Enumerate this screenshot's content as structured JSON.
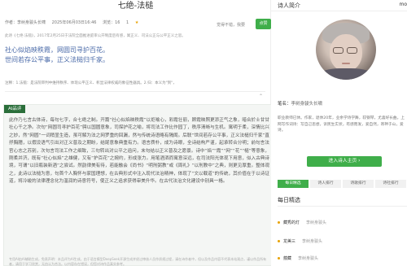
{
  "poem": {
    "title": "七绝-法槌",
    "meta_author": "作者：李树身骏头长啸",
    "meta_date": "2025年06月03日16:46",
    "meta_views": "浏览：16",
    "meta_stars": "1",
    "meta_feel_label": "觉得不错，我要",
    "like_label": "点赞",
    "description": "此诗《七绝·法槌》，2017年2月25日于法院全面推进庭审公开制度后有感，寓正义、司法公正与公平正义之思。",
    "lines": [
      "社心似焰映秩霞，网圆司寻护百花。",
      "世间若存公平事，正义法槌归千家。"
    ],
    "note": "注释：1.法槌：是法院审判中维持秩序、体现公平正义、彰显法律权威的象征性器具。2.归：本义为\"到\"，"
  },
  "ai": {
    "tag": "AI品评",
    "text": "此作乃七言古体诗，每句七字，合七绝之制。开篇“社心似焰映秩霞”以炬喻心，彩霞壮丽，顾霞映照更添正气之象，暗合於士甘甘社心千之净。次句“网圆司寻护百花”骋以国圆意象，司探护花之喻，将司法工作比作园丁，秩序清晰与生机。寓明于柔，深情比兴之妙，然“网圆”一词稍显生造，虽可解为法之网罗重的回漏，然与传统诗语略有隔阂。后联“世间若存公平事，正义法槌归千家”直抒胸臆，以假设语气引出对正义普及之期盼，结尾意象典重有力。语言质朴，成为诗眼，全诗结构严谨，起承转合分明；前句言法官心志之苏别，次句言司法工作之细致，三句转出对公平之追问，末句结以正义普及之愿景。诗中“焰”“霞”“网”“花”“槌”等意象，刚柔并济，既有“社心似焰”之雄健，又有“护百花”之婉约，形成张力。用笔酒洒而寓意深远，在司法阳光体现下用意，似入古典诗境，可谓“以旧瓶装新酒”之尝试。然韵律美有待，若能融会《尚书》“明刑弼教”或《周礼》“以刑教中”之典，则更见厚重。整体观之，此诗以法槌为意，句首个人胸怀与家国理想，在古典形式中注入现代法治精神，体现了“文以载道”的传统，其价值在于以诗证道，将冷峻的法律理念化为温润的诗意符号，使正义之追求获得审美升华。在古代法治文化建设中别具一格。",
    "disclaimer": "专用AI由AI辅助生成，免责声明：本品评为AI生成，由于语言模型DeepSeek开源生成并经过审核人员作质规过程，请在诗作者中，但以及作品内容不代表本站观点，谨以作品所有者，请用于学习欣赏，无由认为合法。以内容存在错误，但您对诗作品真实参考。"
  },
  "sidebar": {
    "header_title": "诗人简介",
    "header_more": "mo",
    "pen_name_label": "笔名：",
    "pen_name": "李树身骏头长啸",
    "bio": "职业教师已休。作家，退休20年，业余学诗学舞，较钢琴，尤喜好长曲。上网写作词诗：写自己思想，诉民生实状，有感而发，爱自然，寄神于山，爱诗。",
    "enter_label": "进入诗人主页 ›",
    "tabs": [
      "每日精选",
      "诗人排行",
      "诗歌排行",
      "诗社排行"
    ],
    "daily_title": "每日精选",
    "daily": [
      {
        "name": "藏秀的灯",
        "author": "李树身骏头"
      },
      {
        "name": "龙美三",
        "author": "李树身骏头"
      },
      {
        "name": "蕴藏",
        "author": "李树身骏头"
      }
    ]
  },
  "colors": {
    "accent_green": "#3fae4a",
    "dark_green": "#2a6e3a",
    "poem_blue": "#4a6aa8",
    "star": "#e8a200"
  }
}
